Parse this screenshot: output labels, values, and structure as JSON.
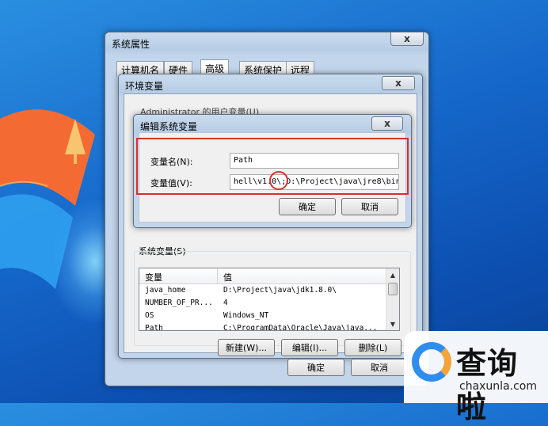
{
  "system_properties": {
    "title": "系统属性",
    "close_label": "x",
    "tabs": [
      {
        "label": "计算机名"
      },
      {
        "label": "硬件"
      },
      {
        "label": "高级"
      },
      {
        "label": "系统保护"
      },
      {
        "label": "远程"
      }
    ],
    "ok_label": "确定",
    "cancel_label": "取消"
  },
  "env_vars": {
    "title": "环境变量",
    "user_section_label": "Administrator 的用户变量(U)",
    "system_section_label": "系统变量(S)",
    "columns": [
      "变量",
      "值"
    ],
    "rows": [
      {
        "name": "java_home",
        "value": "D:\\Project\\java\\jdk1.8.0\\"
      },
      {
        "name": "NUMBER_OF_PR...",
        "value": "4"
      },
      {
        "name": "OS",
        "value": "Windows_NT"
      },
      {
        "name": "Path",
        "value": "C:\\ProgramData\\Oracle\\Java\\java..."
      }
    ],
    "new_label": "新建(W)...",
    "edit_label": "编辑(I)...",
    "delete_label": "删除(L)"
  },
  "edit_dialog": {
    "title": "编辑系统变量",
    "close_label": "x",
    "name_label": "变量名(N):",
    "name_value": "Path",
    "value_label": "变量值(V):",
    "value_value": "hell\\v1.0\\;D:\\Project\\java\\jre8\\bin",
    "ok_label": "确定",
    "cancel_label": "取消"
  },
  "watermark": {
    "brand": "查询啦",
    "domain": "chaxunla.com"
  },
  "colors": {
    "highlight": "#d9302b",
    "desktop_blue": "#1566c9"
  }
}
